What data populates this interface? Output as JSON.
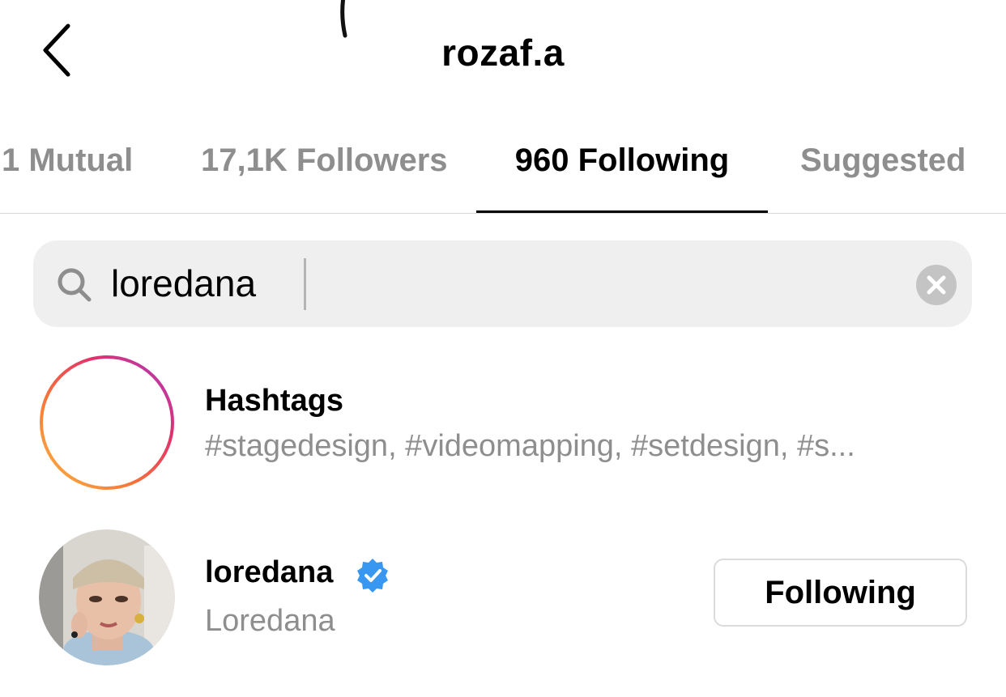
{
  "header": {
    "title": "rozaf.a",
    "back_icon": "chevron-left-icon"
  },
  "tabs": [
    {
      "label": "1 Mutual",
      "active": false
    },
    {
      "label": "17,1K Followers",
      "active": false
    },
    {
      "label": "960 Following",
      "active": true
    },
    {
      "label": "Suggested",
      "active": false
    }
  ],
  "search": {
    "value": "loredana",
    "icon": "search-icon",
    "clear_icon": "clear-icon"
  },
  "results": [
    {
      "type": "hashtags",
      "title": "Hashtags",
      "subtitle": "#stagedesign, #videomapping, #setdesign, #s...",
      "icon": "hashtag-icon"
    },
    {
      "type": "user",
      "username": "loredana",
      "full_name": "Loredana",
      "verified": true,
      "button_label": "Following"
    }
  ],
  "colors": {
    "accent_text": "#000000",
    "muted_text": "#8e8e8e",
    "search_bg": "#efefef",
    "verified_blue": "#3897f0",
    "gradient": [
      "#d62976",
      "#fa7e1e",
      "#feda75",
      "#962fbf"
    ]
  }
}
